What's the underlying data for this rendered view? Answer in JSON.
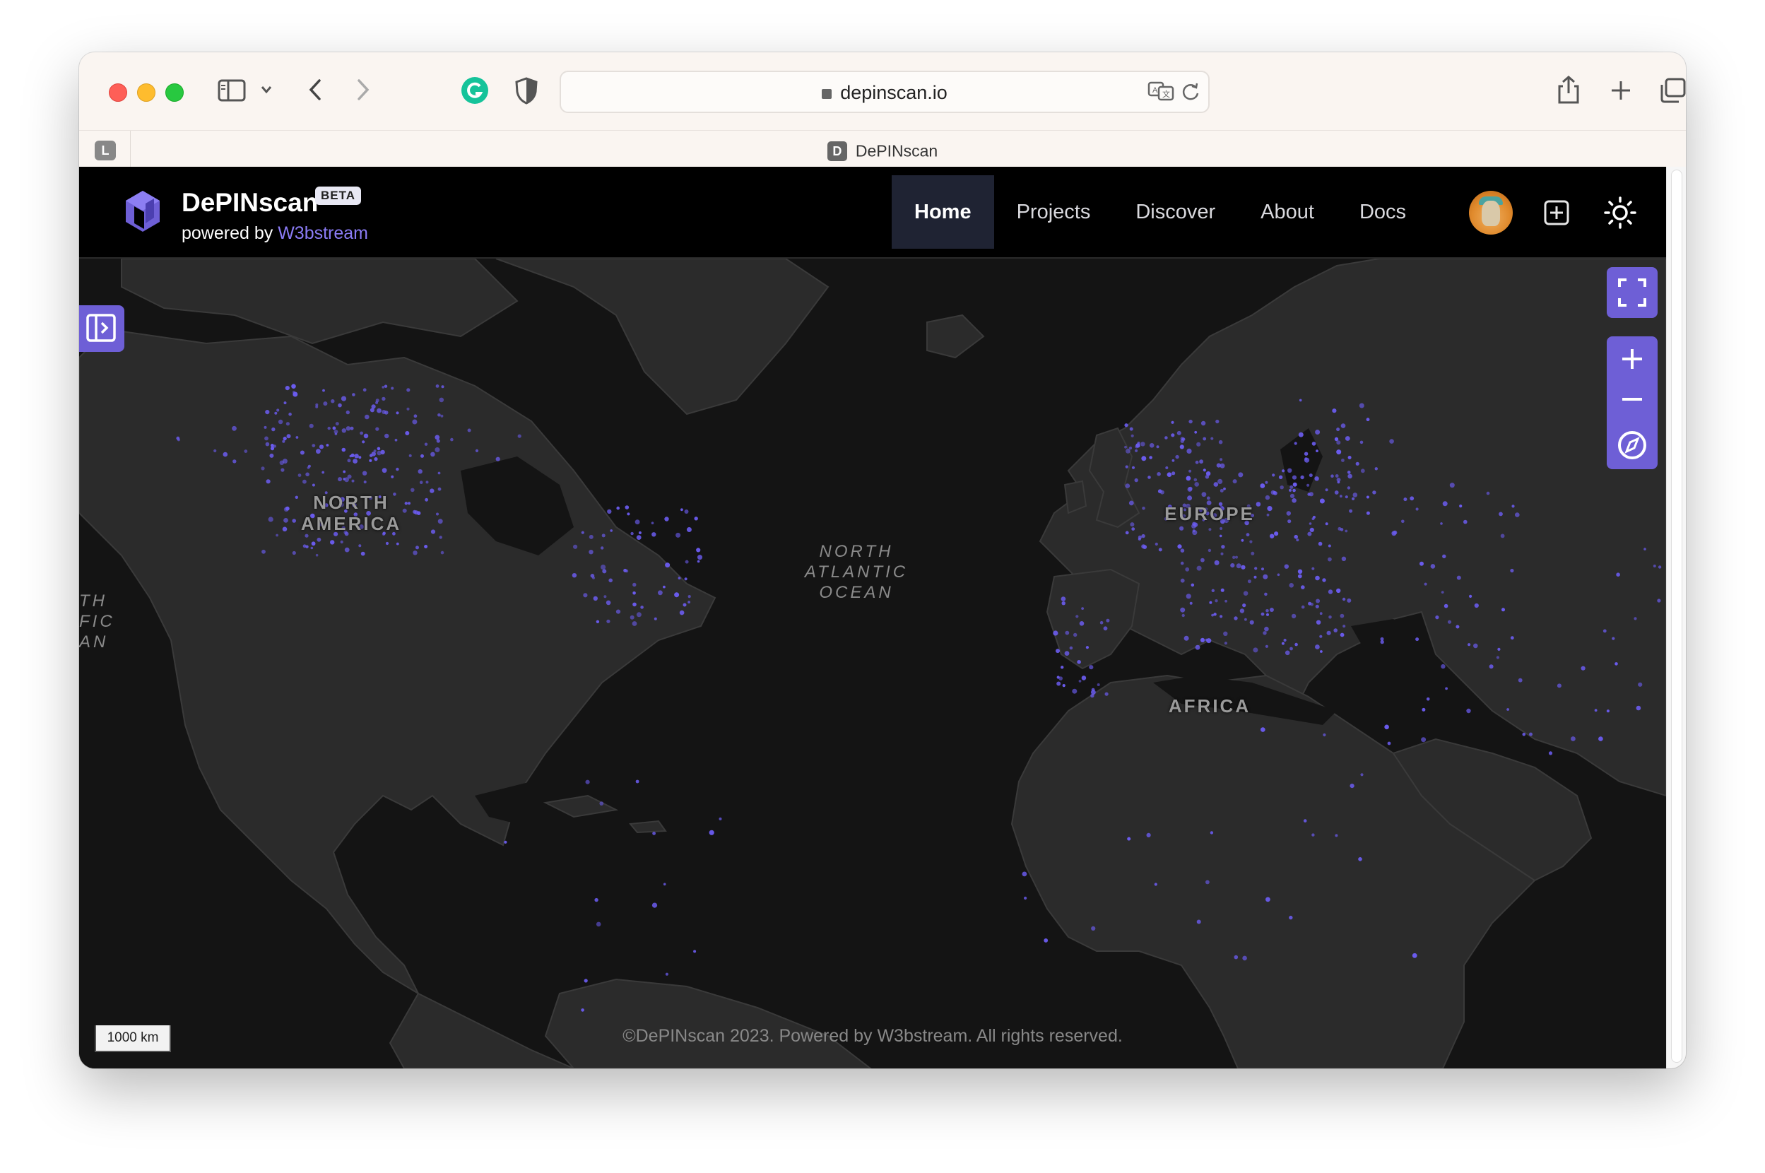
{
  "browser": {
    "url": "depinscan.io",
    "tab_title": "DePINscan",
    "tab_favicon_letter": "D",
    "left_tab_badge": "L"
  },
  "header": {
    "brand": "DePINscan",
    "badge": "BETA",
    "powered_prefix": "powered by",
    "powered_link": "W3bstream",
    "nav": [
      {
        "label": "Home",
        "active": true
      },
      {
        "label": "Projects",
        "active": false
      },
      {
        "label": "Discover",
        "active": false
      },
      {
        "label": "About",
        "active": false
      },
      {
        "label": "Docs",
        "active": false
      }
    ]
  },
  "map": {
    "labels": {
      "north_america": "NORTH\nAMERICA",
      "europe": "EUROPE",
      "africa": "AFRICA",
      "ocean": "NORTH\nATLANTIC\nOCEAN",
      "pacific_partial": "TH\nFIC\nAN"
    },
    "scale": "1000 km",
    "footer": "©DePINscan 2023. Powered by W3bstream. All rights reserved.",
    "colors": {
      "land": "#2b2b2b",
      "water": "#141414",
      "dots": "#6b5cf0",
      "accent": "#6e5fd6"
    }
  }
}
